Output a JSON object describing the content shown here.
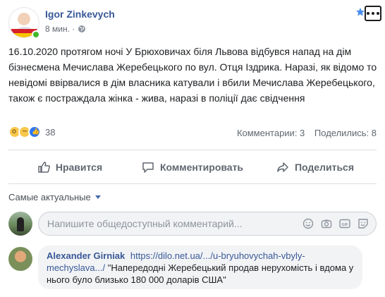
{
  "post": {
    "author": "Igor Zinkevych",
    "time": "8 мин. ·",
    "text": "16.10.2020 протягом ночі У Брюховичах біля Львова відбувся напад на дім бізнесмена Мечислава Жеребецького по вул. Отця Іздрика. Наразі, як відомо то невідомі ввірвалися в дім власника катували і вбили Мечислава Жеребецького, також є постраждала жінка - жива, наразі в поліції дає свідчення",
    "reaction_count": "38",
    "comments_stat": "Комментарии: 3",
    "shares_stat": "Поделились: 8"
  },
  "actions": {
    "like": "Нравится",
    "comment": "Комментировать",
    "share": "Поделиться"
  },
  "sort_label": "Самые актуальные",
  "comment_input": {
    "placeholder": "Напишите общедоступный комментарий..."
  },
  "comment": {
    "author": "Alexander Girniak",
    "link": "https://dilo.net.ua/.../u-bryuhovychah-vbyly-mechyslava.../",
    "text": "\"Напередодні Жеребецький продав нерухомість і вдома у нього було близько 180 000 доларів США\""
  },
  "colors": {
    "link": "#385898",
    "online": "#42b72a",
    "like_blue": "#2f78f0"
  },
  "icons": [
    "globe-icon",
    "star-icon",
    "more-icon",
    "like-icon",
    "comment-icon",
    "share-icon",
    "emoji-icon",
    "camera-icon",
    "gif-icon",
    "sticker-icon"
  ]
}
